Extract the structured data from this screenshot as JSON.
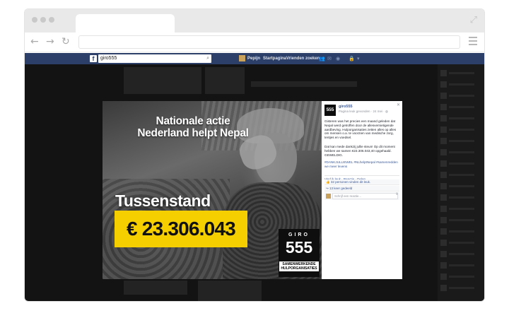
{
  "facebook": {
    "search_value": "giro555",
    "nav": {
      "user": "Pepijn",
      "home": "Startpagina",
      "find_friends": "Vrienden zoeken"
    }
  },
  "photo": {
    "headline": "Nationale actie Nederland helpt Nepal",
    "status_label": "Tussenstand",
    "amount": "€ 23.306.043",
    "logo": {
      "top": "GIRO",
      "number": "555",
      "subtitle": "SAMENWERKENDE HULPORGANISATIES"
    }
  },
  "post": {
    "page_name": "giro555",
    "meta": "Pagina leuk gevonden · 24 mei · ",
    "paragraphs": [
      "Gisteren was het precies een maand geleden dat Nepal werd getroffen door de allesvernietigende aardbeving. Hulporganisaties zetten alles op alles om mensen o.a. te voorzien van medische zorg, tentjes en voedsel.",
      "Dat kan mede dankzij jullie steun! Op dit moment hebben we samen €23.306.043,40 opgehaald. GEWELDIG."
    ],
    "hashtags": "#DANKJULLIEWEL #NLhelptNepal #samenredden we meer levens",
    "actions": "Vind ik leuk · Reactie · Delen",
    "likes": "32 personen vinden dit leuk.",
    "shares": "13 keer gedeeld",
    "comment_placeholder": "Schrijf een reactie..."
  },
  "colors": {
    "facebook_blue": "#2b3f68",
    "amount_yellow": "#f6cf00",
    "link": "#3b5998"
  }
}
